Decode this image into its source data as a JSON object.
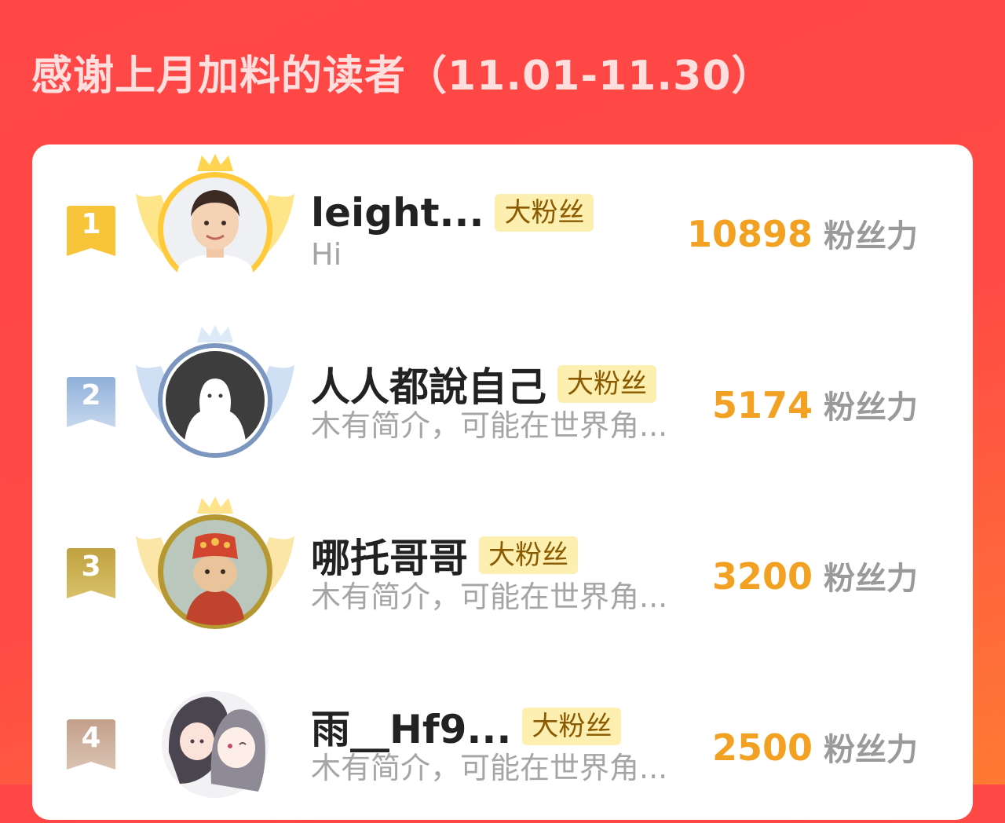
{
  "page": {
    "title": "感谢上月加料的读者（11.01-11.30）"
  },
  "colors": {
    "background": "#ff4a45",
    "card": "#ffffff",
    "score": "#f2a122",
    "badge_bg": "#fcefb0",
    "gold": "#f8c53a",
    "silver": "#9db8dc",
    "bronze": "#c7a94a",
    "plain": "#c9a48f"
  },
  "readers": [
    {
      "rank": "1",
      "name": "leight...",
      "badge": "大粉丝",
      "bio": "Hi",
      "score": "10898",
      "unit": "粉丝力",
      "avatar_icon": "boy-photo-icon",
      "frame": "gold-crown-wings"
    },
    {
      "rank": "2",
      "name": "人人都說自己",
      "badge": "大粉丝",
      "bio": "木有简介，可能在世界角...",
      "score": "5174",
      "unit": "粉丝力",
      "avatar_icon": "default-ghost-icon",
      "frame": "silver-crown-wings"
    },
    {
      "rank": "3",
      "name": "哪托哥哥",
      "badge": "大粉丝",
      "bio": "木有简介，可能在世界角...",
      "score": "3200",
      "unit": "粉丝力",
      "avatar_icon": "cat-costume-icon",
      "frame": "bronze-crown-wings"
    },
    {
      "rank": "4",
      "name": "雨__Hf9...",
      "badge": "大粉丝",
      "bio": "木有简介，可能在世界角...",
      "score": "2500",
      "unit": "粉丝力",
      "avatar_icon": "anime-girls-icon",
      "frame": "none"
    }
  ]
}
